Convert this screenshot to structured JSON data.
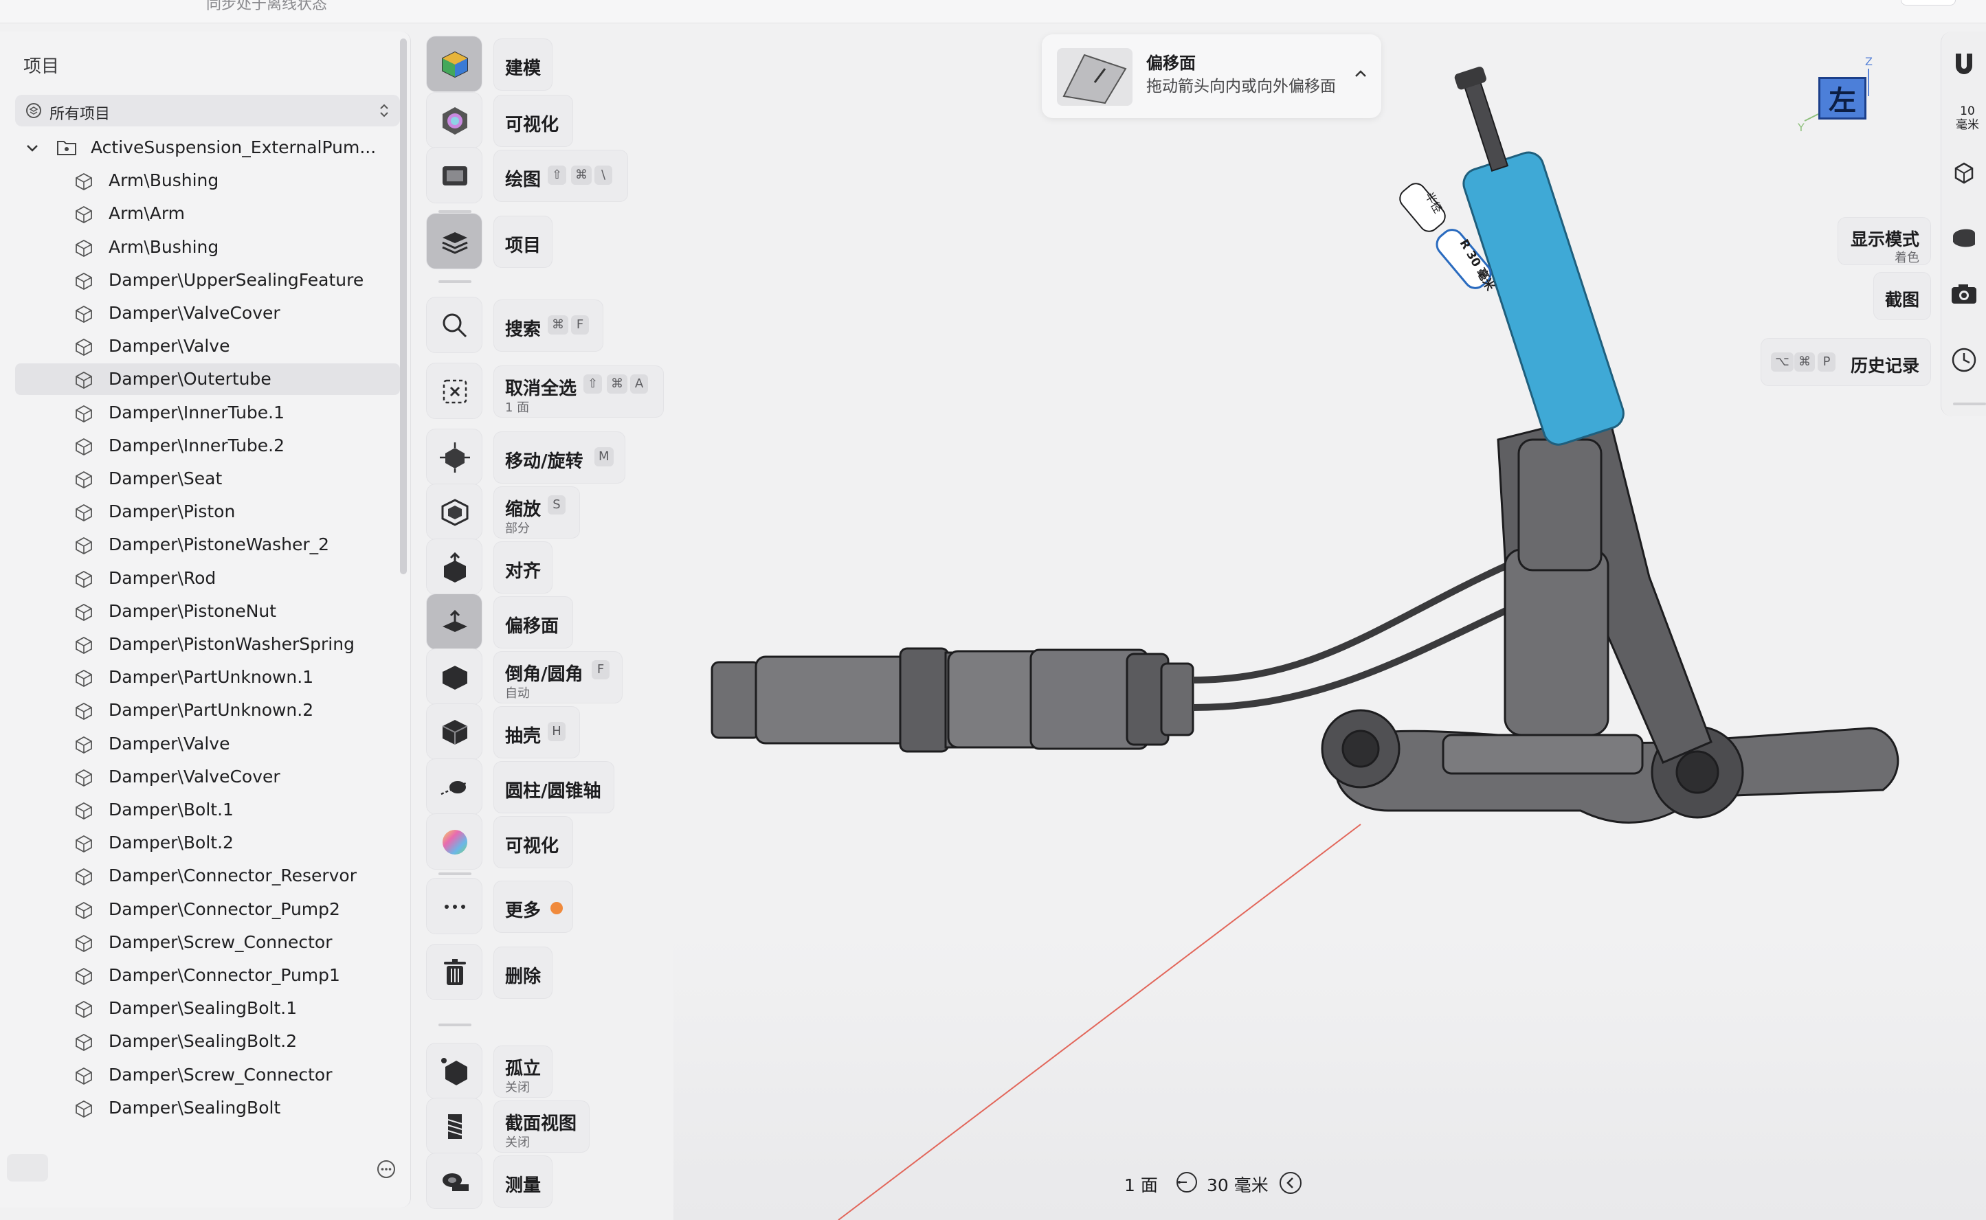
{
  "topbar": {
    "status_text": "同步处于离线状态"
  },
  "sidebar": {
    "title": "项目",
    "filter": {
      "label": "所有项目"
    },
    "root": {
      "label": "ActiveSuspension_ExternalPum..."
    },
    "items": [
      "Arm\\Bushing",
      "Arm\\Arm",
      "Arm\\Bushing",
      "Damper\\UpperSealingFeature",
      "Damper\\ValveCover",
      "Damper\\Valve",
      "Damper\\Outertube",
      "Damper\\InnerTube.1",
      "Damper\\InnerTube.2",
      "Damper\\Seat",
      "Damper\\Piston",
      "Damper\\PistoneWasher_2",
      "Damper\\Rod",
      "Damper\\PistoneNut",
      "Damper\\PistonWasherSpring",
      "Damper\\PartUnknown.1",
      "Damper\\PartUnknown.2",
      "Damper\\Valve",
      "Damper\\ValveCover",
      "Damper\\Bolt.1",
      "Damper\\Bolt.2",
      "Damper\\Connector_Reservor",
      "Damper\\Connector_Pump2",
      "Damper\\Screw_Connector",
      "Damper\\Connector_Pump1",
      "Damper\\SealingBolt.1",
      "Damper\\SealingBolt.2",
      "Damper\\Screw_Connector",
      "Damper\\SealingBolt"
    ],
    "selected_item": "Damper\\Outertube"
  },
  "toolbar": {
    "modeling": "建模",
    "visualize_top": "可视化",
    "sketch": "绘图",
    "sketch_keys": [
      "⇧",
      "⌘",
      "\\"
    ],
    "project": "项目",
    "search": "搜索",
    "search_keys": [
      "⌘",
      "F"
    ],
    "deselect": "取消全选",
    "deselect_sub": "1 面",
    "deselect_keys": [
      "⇧",
      "⌘",
      "A"
    ],
    "move_rotate": "移动/旋转",
    "move_key": "M",
    "scale": "缩放",
    "scale_sub": "部分",
    "scale_key": "S",
    "align": "对齐",
    "offset_face": "偏移面",
    "fillet": "倒角/圆角",
    "fillet_sub": "自动",
    "fillet_key": "F",
    "shell": "抽壳",
    "shell_key": "H",
    "cylinder_axis": "圆柱/圆锥轴",
    "visualize": "可视化",
    "more": "更多",
    "delete": "删除",
    "isolate": "孤立",
    "isolate_sub": "关闭",
    "section_view": "截面视图",
    "section_sub": "关闭",
    "measure": "测量"
  },
  "hint": {
    "title": "偏移面",
    "description": "拖动箭头向内或向外偏移面"
  },
  "navcube": {
    "face": "左",
    "axis_z": "Z",
    "axis_y": "Y"
  },
  "right_panel": {
    "scale_value": "10",
    "scale_unit": "毫米",
    "display_mode": "显示模式",
    "display_mode_sub": "着色",
    "screenshot": "截图",
    "history": "历史记录",
    "history_keys": [
      "⌥",
      "⌘",
      "P"
    ]
  },
  "viewport": {
    "dim_label_1": "半径",
    "dim_label_2": "R 30 毫米"
  },
  "status": {
    "face_count": "1 面",
    "snap_value": "30 毫米"
  },
  "colors": {
    "selected_part": "#3fa9d6",
    "accent_dot": "#f08a3c",
    "axis_line": "#e2665a"
  }
}
